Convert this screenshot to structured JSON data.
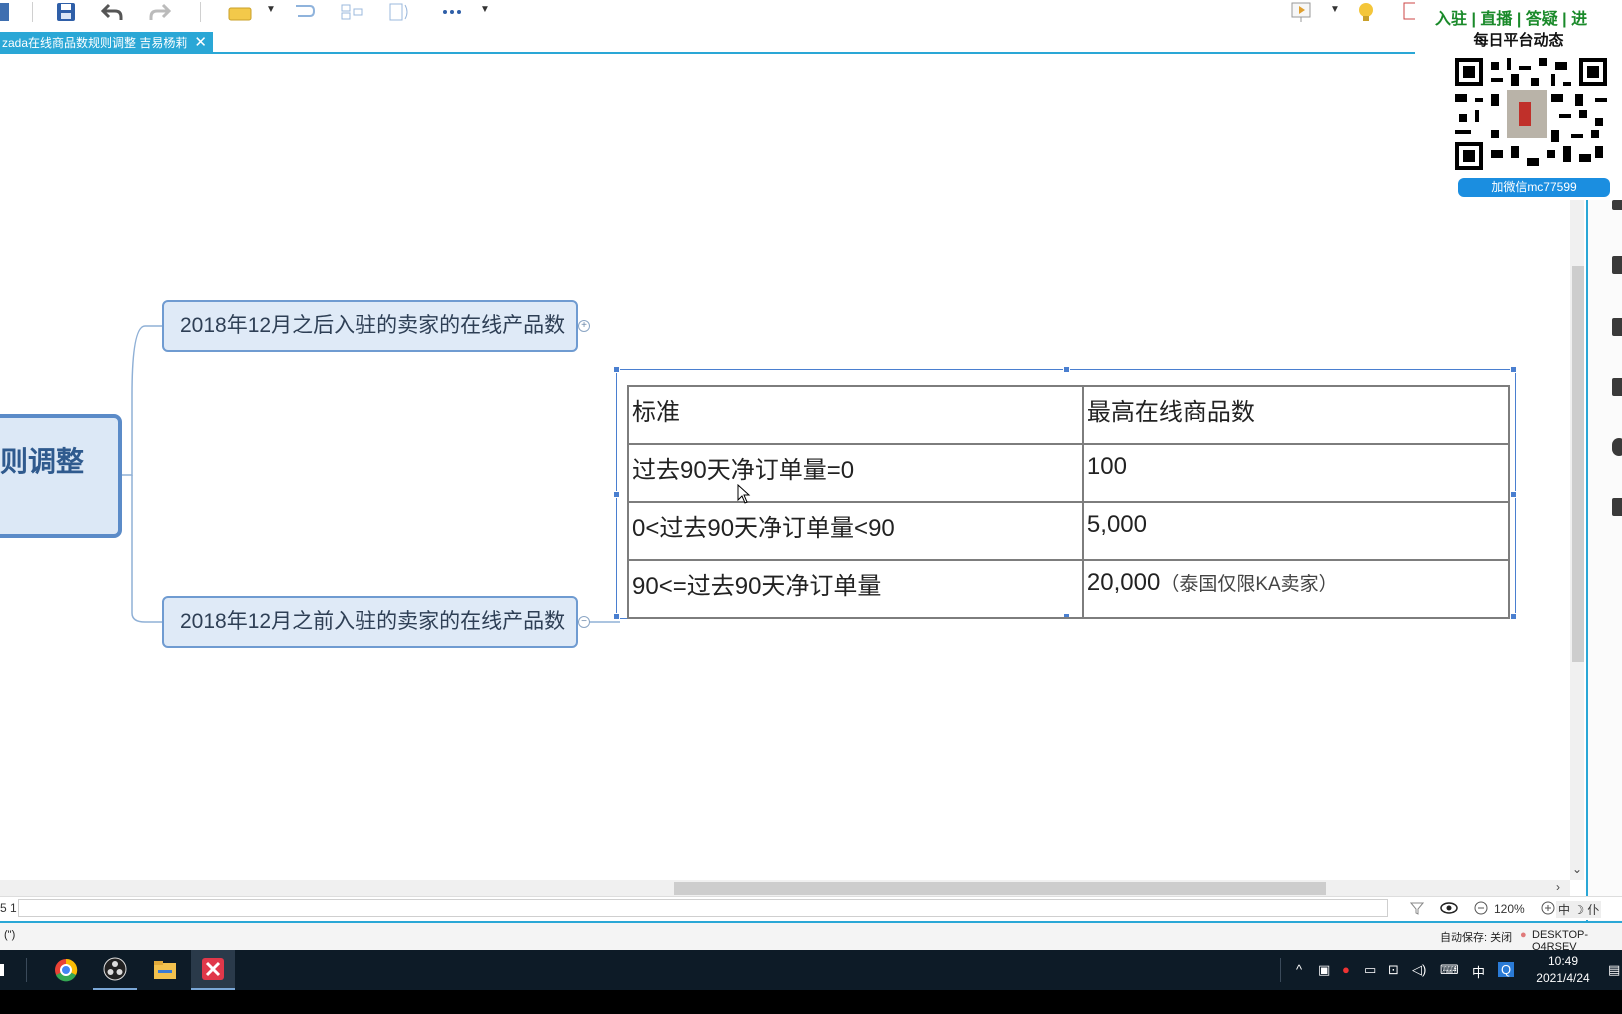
{
  "tab": {
    "title": "zada在线商品数规则调整 吉易杨莉",
    "close": "✕"
  },
  "central_topic": {
    "label": "则调整"
  },
  "branches": [
    {
      "label": "2018年12月之后入驻的卖家的在线产品数",
      "expander": "+"
    },
    {
      "label": "2018年12月之前入驻的卖家的在线产品数",
      "expander": "−"
    }
  ],
  "table": {
    "headers": [
      "标准",
      "最高在线商品数"
    ],
    "rows": [
      {
        "criterion": "过去90天净订单量=0",
        "max": "100",
        "note": ""
      },
      {
        "criterion": "0<过去90天净订单量<90",
        "max": "5,000",
        "note": ""
      },
      {
        "criterion": "90<=过去90天净订单量",
        "max": "20,000",
        "note": "（泰国仅限KA卖家）"
      }
    ]
  },
  "statusbar": {
    "sheet": "5 1",
    "zoom": "120%",
    "info": "(\")",
    "autosave": "自动保存: 关闭",
    "computer": "DESKTOP-Q4RSEV",
    "ime": "中 ☽ 仆"
  },
  "promo": {
    "top": "入驻 | 直播 | 答疑 | 进",
    "subtitle": "每日平台动态",
    "wechat": "加微信mc77599"
  },
  "taskbar": {
    "ime": "中",
    "time": "10:49",
    "date": "2021/4/24"
  },
  "colors": {
    "accent": "#2aa7d6",
    "node_border": "#6f9bd1",
    "node_fill": "#dfeaf7",
    "promo_green": "#1a8a2a",
    "wechat_blue": "#1b8ee0"
  }
}
